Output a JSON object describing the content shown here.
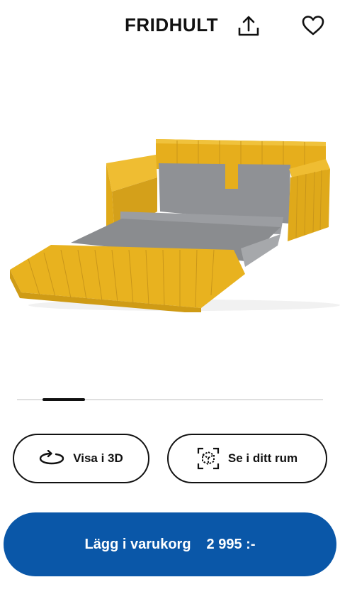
{
  "header": {
    "title": "FRIDHULT",
    "share_icon": "share-icon",
    "favorite_icon": "heart-icon"
  },
  "gallery": {
    "image_subject": "sofa-bed-yellow",
    "slide_indicator_position": 0.14
  },
  "actions": {
    "view_3d_label": "Visa i 3D",
    "view_3d_icon": "rotate-3d-icon",
    "room_label": "Se i ditt rum",
    "room_icon": "ar-cube-icon"
  },
  "cart": {
    "label": "Lägg i varukorg",
    "price": "2 995 :-"
  },
  "colors": {
    "primary_blue": "#0a57a8",
    "sofa_yellow": "#e8b21f",
    "mattress_grey": "#8a8c8f"
  }
}
